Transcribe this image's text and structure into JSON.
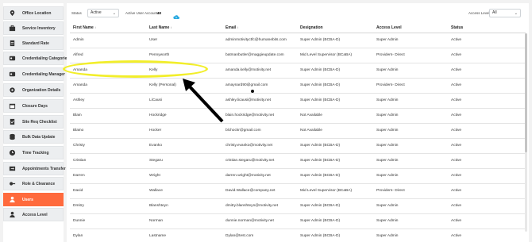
{
  "sidebar": {
    "items": [
      {
        "label": "Office Location",
        "icon": "location-pin-icon"
      },
      {
        "label": "Service Inventory",
        "icon": "briefcase-icon"
      },
      {
        "label": "Standard Rate",
        "icon": "document-icon"
      },
      {
        "label": "Credentialing Categories",
        "icon": "badge-icon"
      },
      {
        "label": "Credentialing Manager",
        "icon": "badge-icon"
      },
      {
        "label": "Organization Details",
        "icon": "gear-icon"
      },
      {
        "label": "Closure Days",
        "icon": "calendar-icon"
      },
      {
        "label": "Site Req Checklist",
        "icon": "checklist-icon"
      },
      {
        "label": "Bulk Data Update",
        "icon": "database-icon"
      },
      {
        "label": "Time Tracking",
        "icon": "clock-icon"
      },
      {
        "label": "Appointments Transfer",
        "icon": "transfer-icon"
      },
      {
        "label": "Role & Clearance",
        "icon": "key-icon"
      },
      {
        "label": "Users",
        "icon": "users-icon",
        "active": true
      },
      {
        "label": "Access Level",
        "icon": "user-icon"
      }
    ]
  },
  "filters": {
    "status_label": "Status",
    "status_value": "Active",
    "active_accounts_label": "Active User Accounts:",
    "active_accounts_count": "48",
    "access_level_label": "Access Level",
    "access_level_value": "All"
  },
  "table": {
    "headers": [
      "First Name",
      "Last Name",
      "Email",
      "Designation",
      "Access Level",
      "Status"
    ],
    "rows": [
      [
        "Admin",
        "User",
        "adminmotivityctfc@humanebits.com",
        "Super Admin (BCBA-D)",
        "Super Admin",
        "Active"
      ],
      [
        "Alfred",
        "Pennyworth",
        "batmanbutler@maggieupdate.com",
        "Mid Level Supervisor (BCaBA)",
        "Providers- Direct",
        "Active"
      ],
      [
        "Amanda",
        "Kelly",
        "amanda.kelly@motivity.net",
        "Super Admin (BCBA-D)",
        "Super Admin",
        "Active"
      ],
      [
        "Amanda",
        "Kelly (Personal)",
        "amaynard90@gmail.com",
        "Super Admin (BCBA-D)",
        "Providers- Direct",
        "Active"
      ],
      [
        "Ashley",
        "LiCausi",
        "ashley.licausi@motivity.net",
        "Super Admin (BCBA-D)",
        "Super Admin",
        "Active"
      ],
      [
        "Blain",
        "Hockridge",
        "blain.hockridge@motivity.net",
        "Not Available",
        "Super Admin",
        "Active"
      ],
      [
        "Blaino",
        "Hocker",
        "blchockr@gmail.com",
        "Not Available",
        "Super Admin",
        "Active"
      ],
      [
        "Christy",
        "Evanko",
        "christy.evanko@motivity.net",
        "Super Admin (BCBA-D)",
        "Super Admin",
        "Active"
      ],
      [
        "Cristian",
        "Stegaru",
        "cristian.stegaru@motivity.net",
        "Super Admin (BCBA-D)",
        "Super Admin",
        "Active"
      ],
      [
        "Darren",
        "Wright",
        "darren.wright@motivity.net",
        "Super Admin (BCBA-D)",
        "Super Admin",
        "Active"
      ],
      [
        "David",
        "Wallace",
        "David.Wallace@company.net",
        "Mid Level Supervisor (BCaBA)",
        "Providers- Direct",
        "Active"
      ],
      [
        "Dmitry",
        "Blanshteyn",
        "dmitry.blanshteyn@motivity.net",
        "Super Admin (BCBA-D)",
        "Super Admin",
        "Active"
      ],
      [
        "Dunnie",
        "Norman",
        "dunnie.norman@motivity.net",
        "Super Admin (BCBA-D)",
        "Super Admin",
        "Active"
      ],
      [
        "Dylan",
        "Lastname",
        "Dylan@test.com",
        "Super Admin (BCBA-D)",
        "Super Admin",
        "Active"
      ]
    ]
  },
  "colors": {
    "accent": "#ff6a3d",
    "highlight": "#f2ee2a",
    "cloud": "#29a9e0"
  }
}
